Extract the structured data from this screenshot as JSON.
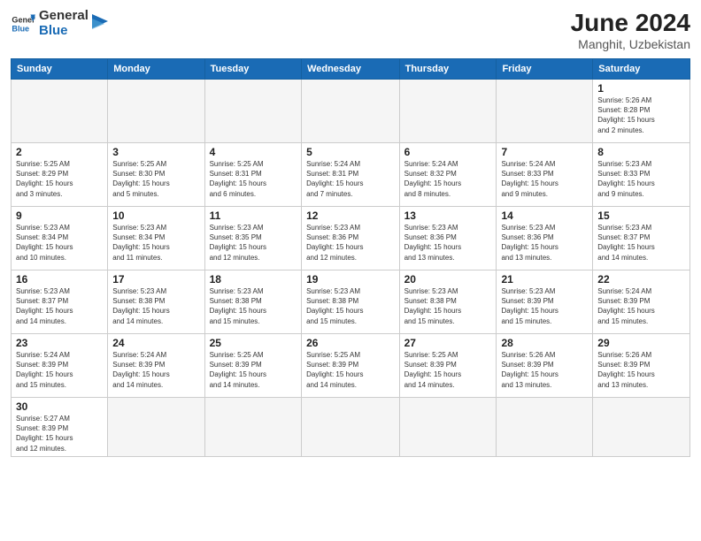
{
  "logo": {
    "general": "General",
    "blue": "Blue"
  },
  "title": "June 2024",
  "subtitle": "Manghit, Uzbekistan",
  "weekdays": [
    "Sunday",
    "Monday",
    "Tuesday",
    "Wednesday",
    "Thursday",
    "Friday",
    "Saturday"
  ],
  "weeks": [
    [
      {
        "day": "",
        "info": ""
      },
      {
        "day": "",
        "info": ""
      },
      {
        "day": "",
        "info": ""
      },
      {
        "day": "",
        "info": ""
      },
      {
        "day": "",
        "info": ""
      },
      {
        "day": "",
        "info": ""
      },
      {
        "day": "1",
        "info": "Sunrise: 5:26 AM\nSunset: 8:28 PM\nDaylight: 15 hours\nand 2 minutes."
      }
    ],
    [
      {
        "day": "2",
        "info": "Sunrise: 5:25 AM\nSunset: 8:29 PM\nDaylight: 15 hours\nand 3 minutes."
      },
      {
        "day": "3",
        "info": "Sunrise: 5:25 AM\nSunset: 8:30 PM\nDaylight: 15 hours\nand 5 minutes."
      },
      {
        "day": "4",
        "info": "Sunrise: 5:25 AM\nSunset: 8:31 PM\nDaylight: 15 hours\nand 6 minutes."
      },
      {
        "day": "5",
        "info": "Sunrise: 5:24 AM\nSunset: 8:31 PM\nDaylight: 15 hours\nand 7 minutes."
      },
      {
        "day": "6",
        "info": "Sunrise: 5:24 AM\nSunset: 8:32 PM\nDaylight: 15 hours\nand 8 minutes."
      },
      {
        "day": "7",
        "info": "Sunrise: 5:24 AM\nSunset: 8:33 PM\nDaylight: 15 hours\nand 9 minutes."
      },
      {
        "day": "8",
        "info": "Sunrise: 5:23 AM\nSunset: 8:33 PM\nDaylight: 15 hours\nand 9 minutes."
      }
    ],
    [
      {
        "day": "9",
        "info": "Sunrise: 5:23 AM\nSunset: 8:34 PM\nDaylight: 15 hours\nand 10 minutes."
      },
      {
        "day": "10",
        "info": "Sunrise: 5:23 AM\nSunset: 8:34 PM\nDaylight: 15 hours\nand 11 minutes."
      },
      {
        "day": "11",
        "info": "Sunrise: 5:23 AM\nSunset: 8:35 PM\nDaylight: 15 hours\nand 12 minutes."
      },
      {
        "day": "12",
        "info": "Sunrise: 5:23 AM\nSunset: 8:36 PM\nDaylight: 15 hours\nand 12 minutes."
      },
      {
        "day": "13",
        "info": "Sunrise: 5:23 AM\nSunset: 8:36 PM\nDaylight: 15 hours\nand 13 minutes."
      },
      {
        "day": "14",
        "info": "Sunrise: 5:23 AM\nSunset: 8:36 PM\nDaylight: 15 hours\nand 13 minutes."
      },
      {
        "day": "15",
        "info": "Sunrise: 5:23 AM\nSunset: 8:37 PM\nDaylight: 15 hours\nand 14 minutes."
      }
    ],
    [
      {
        "day": "16",
        "info": "Sunrise: 5:23 AM\nSunset: 8:37 PM\nDaylight: 15 hours\nand 14 minutes."
      },
      {
        "day": "17",
        "info": "Sunrise: 5:23 AM\nSunset: 8:38 PM\nDaylight: 15 hours\nand 14 minutes."
      },
      {
        "day": "18",
        "info": "Sunrise: 5:23 AM\nSunset: 8:38 PM\nDaylight: 15 hours\nand 15 minutes."
      },
      {
        "day": "19",
        "info": "Sunrise: 5:23 AM\nSunset: 8:38 PM\nDaylight: 15 hours\nand 15 minutes."
      },
      {
        "day": "20",
        "info": "Sunrise: 5:23 AM\nSunset: 8:38 PM\nDaylight: 15 hours\nand 15 minutes."
      },
      {
        "day": "21",
        "info": "Sunrise: 5:23 AM\nSunset: 8:39 PM\nDaylight: 15 hours\nand 15 minutes."
      },
      {
        "day": "22",
        "info": "Sunrise: 5:24 AM\nSunset: 8:39 PM\nDaylight: 15 hours\nand 15 minutes."
      }
    ],
    [
      {
        "day": "23",
        "info": "Sunrise: 5:24 AM\nSunset: 8:39 PM\nDaylight: 15 hours\nand 15 minutes."
      },
      {
        "day": "24",
        "info": "Sunrise: 5:24 AM\nSunset: 8:39 PM\nDaylight: 15 hours\nand 14 minutes."
      },
      {
        "day": "25",
        "info": "Sunrise: 5:25 AM\nSunset: 8:39 PM\nDaylight: 15 hours\nand 14 minutes."
      },
      {
        "day": "26",
        "info": "Sunrise: 5:25 AM\nSunset: 8:39 PM\nDaylight: 15 hours\nand 14 minutes."
      },
      {
        "day": "27",
        "info": "Sunrise: 5:25 AM\nSunset: 8:39 PM\nDaylight: 15 hours\nand 14 minutes."
      },
      {
        "day": "28",
        "info": "Sunrise: 5:26 AM\nSunset: 8:39 PM\nDaylight: 15 hours\nand 13 minutes."
      },
      {
        "day": "29",
        "info": "Sunrise: 5:26 AM\nSunset: 8:39 PM\nDaylight: 15 hours\nand 13 minutes."
      }
    ],
    [
      {
        "day": "30",
        "info": "Sunrise: 5:27 AM\nSunset: 8:39 PM\nDaylight: 15 hours\nand 12 minutes."
      },
      {
        "day": "",
        "info": ""
      },
      {
        "day": "",
        "info": ""
      },
      {
        "day": "",
        "info": ""
      },
      {
        "day": "",
        "info": ""
      },
      {
        "day": "",
        "info": ""
      },
      {
        "day": "",
        "info": ""
      }
    ]
  ]
}
